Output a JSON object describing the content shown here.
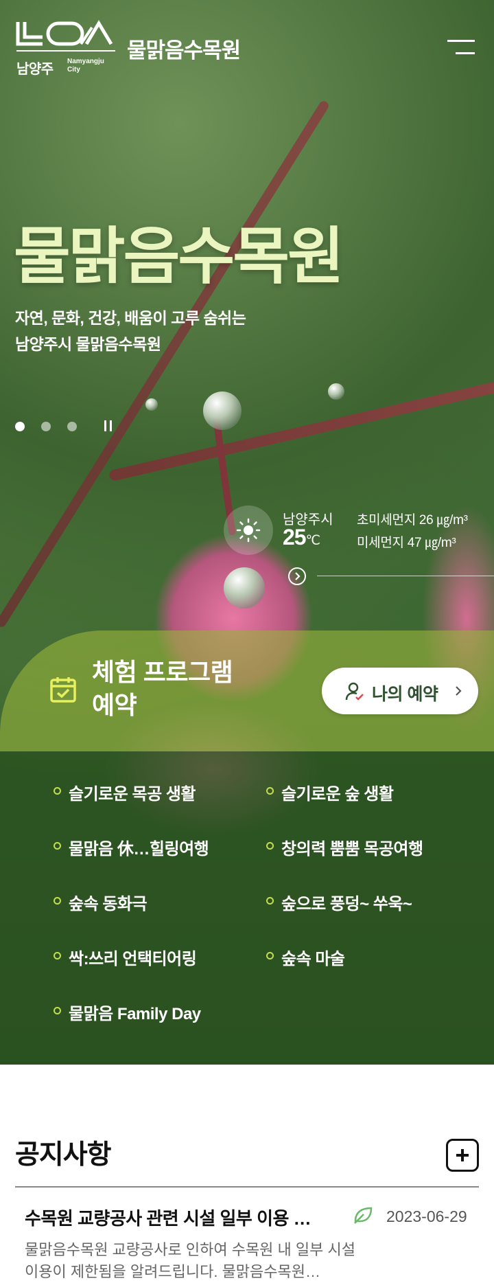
{
  "header": {
    "logo_korean": "남양주",
    "logo_english_1": "Namyangju",
    "logo_english_2": "City",
    "site_name": "물맑음수목원",
    "menu_icon": "hamburger-menu-icon"
  },
  "hero": {
    "title": "물맑음수목원",
    "subtitle_line1": "자연, 문화, 건강, 배움이 고루 숨쉬는",
    "subtitle_line2": "남양주시 물맑음수목원",
    "slides_total": 3,
    "active_slide": 1
  },
  "weather": {
    "icon": "sun-icon",
    "city": "남양주시",
    "temp": "25",
    "unit": "℃",
    "ultrafine_dust": "초미세먼지 26 ㎍/m³",
    "fine_dust": "미세먼지 47 ㎍/m³"
  },
  "program": {
    "title_line1": "체험 프로그램",
    "title_line2": "예약",
    "icon": "calendar-check-icon",
    "my_reservation": "나의 예약",
    "items": [
      "슬기로운 목공 생활",
      "슬기로운 숲 생활",
      "물맑음 休…힐링여행",
      "창의력 뿜뿜 목공여행",
      "숲속 동화극",
      "숲으로 풍덩~ 쑤욱~",
      "싹:쓰리 언택티어링",
      "숲속 마술",
      "물맑음 Family Day"
    ]
  },
  "notice": {
    "title": "공지사항",
    "items": [
      {
        "title": "수목원 교량공사 관련 시설 일부 이용 …",
        "date": "2023-06-29",
        "body_line1": "물맑음수목원 교량공사로 인하여 수목원 내 일부 시설",
        "body_line2": "이용이 제한됨을 알려드립니다. 물맑음수목원…"
      }
    ]
  },
  "colors": {
    "accent_green": "#c6dd4a",
    "title_pale": "#eaf5c0",
    "button_text": "#2f5130"
  }
}
